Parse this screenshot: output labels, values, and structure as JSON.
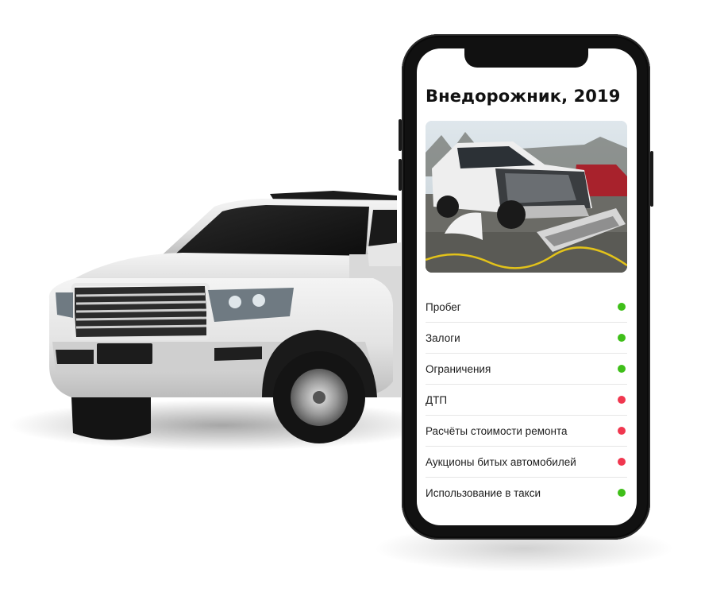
{
  "report": {
    "title": "Внедорожник, 2019",
    "photo_icon": "damaged-car-photo",
    "checks": [
      {
        "label": "Пробег",
        "status": "ok"
      },
      {
        "label": "Залоги",
        "status": "ok"
      },
      {
        "label": "Ограничения",
        "status": "ok"
      },
      {
        "label": "ДТП",
        "status": "warning"
      },
      {
        "label": "Расчёты стоимости ремонта",
        "status": "warning"
      },
      {
        "label": "Аукционы битых автомобилей",
        "status": "warning"
      },
      {
        "label": "Использование в такси",
        "status": "ok"
      }
    ]
  },
  "colors": {
    "ok": "#3fbf19",
    "warning": "#f0374f",
    "phone_frame": "#111111",
    "background": "#ffffff"
  },
  "icons": {
    "hero": "white-suv-car-icon"
  }
}
